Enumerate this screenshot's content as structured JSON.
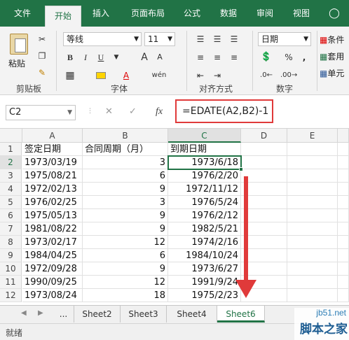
{
  "ribbon_tabs": [
    "文件",
    "开始",
    "插入",
    "页面布局",
    "公式",
    "数据",
    "审阅",
    "视图"
  ],
  "tell_me_icon": "lightbulb-icon",
  "clipboard": {
    "paste": "粘贴",
    "label": "剪贴板"
  },
  "font": {
    "name": "等线",
    "size": "11",
    "label": "字体",
    "bold": "B",
    "italic": "I",
    "underline": "U",
    "bigger": "A",
    "smaller": "A",
    "phonetic": "wén",
    "color_a": "A"
  },
  "alignment": {
    "label": "对齐方式"
  },
  "number": {
    "format": "日期",
    "label": "数字",
    "percent": "%",
    "comma": ","
  },
  "styles": {
    "conditional": "条件",
    "table": "套用",
    "cell": "单元"
  },
  "name_box": "C2",
  "formula_bar": {
    "cancel": "✕",
    "enter": "✓",
    "fx": "fx",
    "formula": "=EDATE(A2,B2)-1"
  },
  "columns": [
    "A",
    "B",
    "C",
    "D",
    "E"
  ],
  "rows": [
    {
      "num": "1",
      "a": "签定日期",
      "b": "合同周期（月）",
      "c": "到期日期"
    },
    {
      "num": "2",
      "a": "1973/03/19",
      "b": "3",
      "c": "1973/6/18"
    },
    {
      "num": "3",
      "a": "1975/08/21",
      "b": "6",
      "c": "1976/2/20"
    },
    {
      "num": "4",
      "a": "1972/02/13",
      "b": "9",
      "c": "1972/11/12"
    },
    {
      "num": "5",
      "a": "1976/02/25",
      "b": "3",
      "c": "1976/5/24"
    },
    {
      "num": "6",
      "a": "1975/05/13",
      "b": "9",
      "c": "1976/2/12"
    },
    {
      "num": "7",
      "a": "1981/08/22",
      "b": "9",
      "c": "1982/5/21"
    },
    {
      "num": "8",
      "a": "1973/02/17",
      "b": "12",
      "c": "1974/2/16"
    },
    {
      "num": "9",
      "a": "1984/04/25",
      "b": "6",
      "c": "1984/10/24"
    },
    {
      "num": "10",
      "a": "1972/09/28",
      "b": "9",
      "c": "1973/6/27"
    },
    {
      "num": "11",
      "a": "1990/09/25",
      "b": "12",
      "c": "1991/9/24"
    },
    {
      "num": "12",
      "a": "1973/08/24",
      "b": "18",
      "c": "1975/2/23"
    }
  ],
  "sheet_tabs": {
    "ellipsis": "...",
    "tabs": [
      "Sheet2",
      "Sheet3",
      "Sheet4",
      "Sheet6"
    ],
    "active": "Sheet6"
  },
  "status": {
    "ready": "就绪"
  },
  "watermark": {
    "site": "jb51.net",
    "brand": "脚本之家"
  },
  "colors": {
    "accent": "#217346",
    "highlight": "#e03a3a"
  }
}
